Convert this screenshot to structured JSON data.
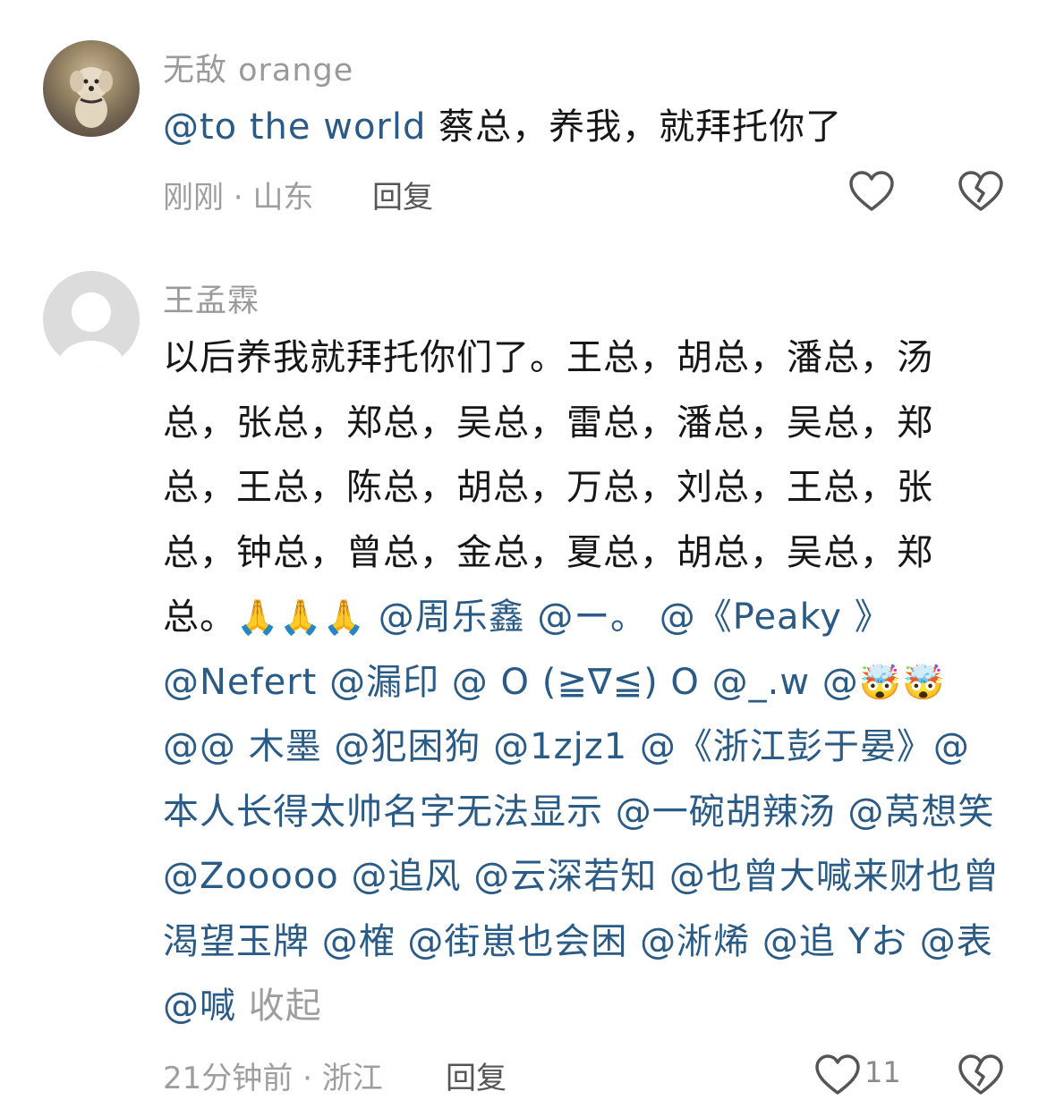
{
  "comments": [
    {
      "username": "无敌 orange",
      "mention": "@to the world",
      "text": " 蔡总，养我，就拜托你了",
      "time": "刚刚",
      "separator": " · ",
      "location": "山东",
      "reply_label": "回复",
      "like_icon": "heart-icon",
      "dislike_icon": "broken-heart-icon"
    },
    {
      "username": "王孟霖",
      "text_plain": "以后养我就拜托你们了。王总，胡总，潘总，汤总，张总，郑总，吴总，雷总，潘总，吴总，郑总，王总，陈总，胡总，万总，刘总，王总，张总，钟总，曾总，金总，夏总，胡总，吴总，郑总。",
      "emoji_pray": "🙏",
      "mentions_line1": [
        "@周乐鑫",
        "@ー。",
        "@《Peaky 》"
      ],
      "mentions_line2": [
        "@Nefert",
        "@漏印",
        "@ O (≧∇≦) O",
        "@_.w",
        "@"
      ],
      "emoji_exploding": "🤯",
      "mentions_rest": "@@ 木墨  @犯困狗  @1zjz1 @《浙江彭于晏》@本人长得太帅名字无法显示  @一碗胡辣汤  @莴想笑  @Zooooo @追风  @云深若知  @也曾大喊来财也曾渴望玉牌  @榷  @街崽也会困  @淅烯  @追 Yお  @表  @喊",
      "collapse_label": "收起",
      "time": "21分钟前",
      "separator": " · ",
      "location": "浙江",
      "reply_label": "回复",
      "like_count": "11",
      "like_icon": "heart-icon",
      "dislike_icon": "broken-heart-icon"
    }
  ]
}
